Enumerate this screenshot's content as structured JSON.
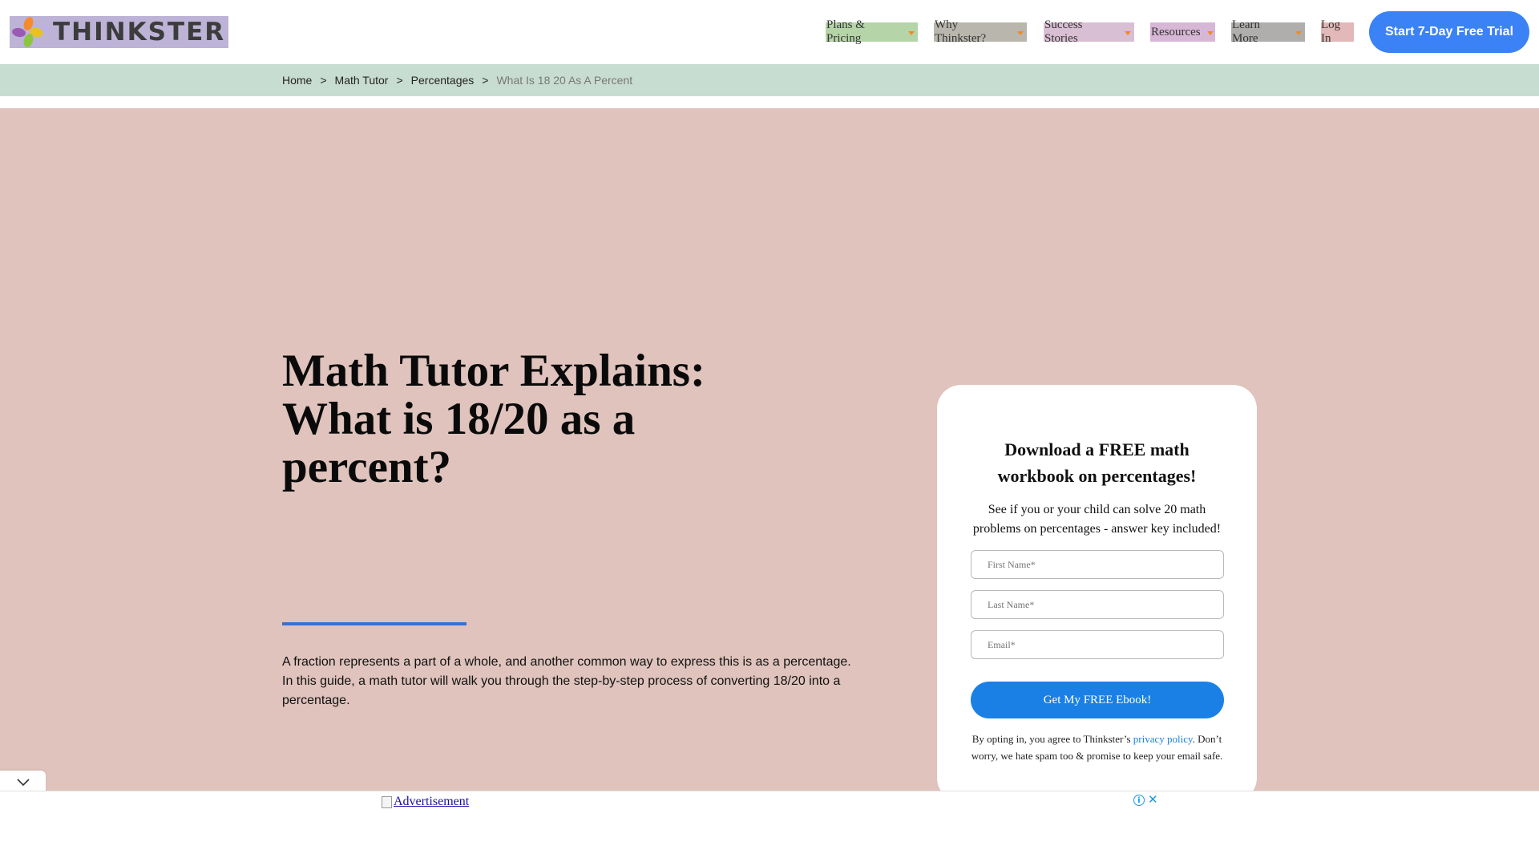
{
  "brand": {
    "logo_text": "THINKSTER",
    "accent_color": "#3b82f6"
  },
  "nav": {
    "items": [
      {
        "label": "Plans & Pricing"
      },
      {
        "label": "Why Thinkster?"
      },
      {
        "label": "Success Stories"
      },
      {
        "label": "Resources"
      },
      {
        "label": "Learn More"
      }
    ],
    "login_label": "Log In",
    "cta_label": "Start 7-Day Free Trial"
  },
  "breadcrumb": {
    "items": [
      "Home",
      "Math Tutor",
      "Percentages"
    ],
    "separator": ">",
    "current": "What Is 18 20 As A Percent"
  },
  "hero": {
    "title": "Math Tutor Explains: What is 18/20 as a percent?",
    "intro": "A fraction represents a part of a whole, and another common way to express this is as a percentage. In this guide, a math tutor will walk you through the step-by-step process of converting 18/20 into a percentage."
  },
  "form": {
    "title": "Download a FREE math workbook on percentages!",
    "subtitle": "See if you or your child can solve 20 math problems on percentages - answer key included!",
    "first_name_placeholder": "First Name*",
    "last_name_placeholder": "Last Name*",
    "email_placeholder": "Email*",
    "submit_label": "Get My FREE Ebook!",
    "legal_before": "By opting in, you agree to Thinkster’s ",
    "privacy_link": "privacy policy",
    "legal_after": ". Don’t worry, we hate spam too & promise to keep your email safe."
  },
  "ad": {
    "link_text": "Advertisement",
    "info_icon": "info-icon",
    "close_icon": "close-icon",
    "toggle_icon": "chevron-down-icon"
  }
}
